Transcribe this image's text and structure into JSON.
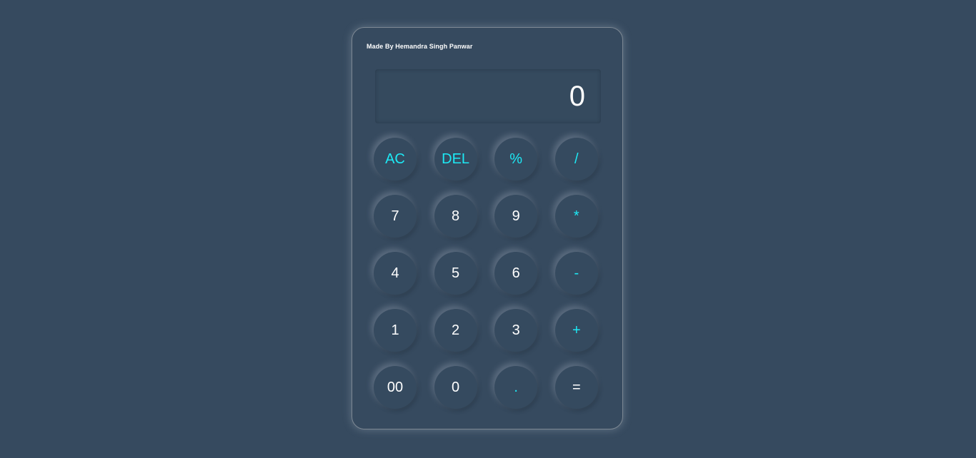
{
  "credit": "Made By Hemandra Singh Panwar",
  "display": {
    "value": "0"
  },
  "colors": {
    "background": "#364a5f",
    "accent": "#1de9f5",
    "text": "#ffffff"
  },
  "keys": [
    {
      "label": "AC",
      "accent": true
    },
    {
      "label": "DEL",
      "accent": true
    },
    {
      "label": "%",
      "accent": true
    },
    {
      "label": "/",
      "accent": true
    },
    {
      "label": "7",
      "accent": false
    },
    {
      "label": "8",
      "accent": false
    },
    {
      "label": "9",
      "accent": false
    },
    {
      "label": "*",
      "accent": true
    },
    {
      "label": "4",
      "accent": false
    },
    {
      "label": "5",
      "accent": false
    },
    {
      "label": "6",
      "accent": false
    },
    {
      "label": "-",
      "accent": true
    },
    {
      "label": "1",
      "accent": false
    },
    {
      "label": "2",
      "accent": false
    },
    {
      "label": "3",
      "accent": false
    },
    {
      "label": "+",
      "accent": true
    },
    {
      "label": "00",
      "accent": false
    },
    {
      "label": "0",
      "accent": false
    },
    {
      "label": ".",
      "accent": true
    },
    {
      "label": "=",
      "accent": false
    }
  ]
}
